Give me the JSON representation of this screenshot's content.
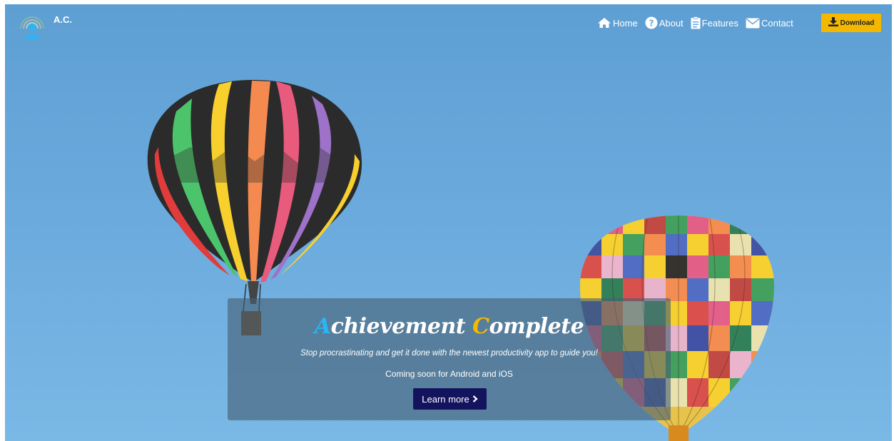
{
  "brand": {
    "name": "A.C.",
    "logo_icon": "person-signal-logo-icon"
  },
  "nav": {
    "items": [
      {
        "label": "Home",
        "icon": "home-icon"
      },
      {
        "label": "About",
        "icon": "question-circle-icon"
      },
      {
        "label": "Features",
        "icon": "clipboard-icon"
      },
      {
        "label": "Contact",
        "icon": "envelope-icon"
      }
    ],
    "download_label": "Download",
    "download_icon": "download-icon"
  },
  "hero": {
    "title_first_initial": "A",
    "title_first_rest": "chievement",
    "title_second_initial": "C",
    "title_second_rest": "omplete",
    "tagline": "Stop procrastinating and get it done with the newest productivity app to guide you!",
    "availability": "Coming soon for Android and iOS",
    "cta_label": "Learn more",
    "cta_icon": "chevron-right-icon"
  },
  "colors": {
    "sky": "#6aa9dc",
    "accent_blue": "#29b6f6",
    "accent_yellow": "#f5b800",
    "button_dark": "#14145e"
  }
}
